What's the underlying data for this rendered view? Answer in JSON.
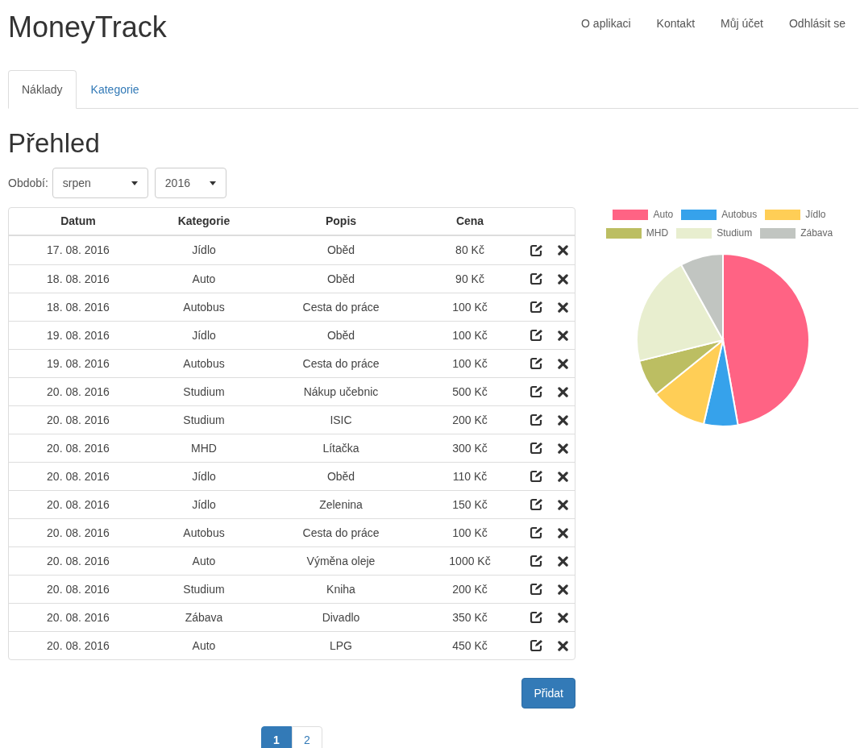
{
  "brand": "MoneyTrack",
  "nav": [
    "O aplikaci",
    "Kontakt",
    "Můj účet",
    "Odhlásit se"
  ],
  "tabs": [
    {
      "label": "Náklady",
      "selected": true
    },
    {
      "label": "Kategorie",
      "selected": false
    }
  ],
  "heading": "Přehled",
  "period": {
    "label": "Období:",
    "month": "srpen",
    "year": "2016"
  },
  "table": {
    "columns": [
      "Datum",
      "Kategorie",
      "Popis",
      "Cena"
    ],
    "rows": [
      [
        "17. 08. 2016",
        "Jídlo",
        "Oběd",
        "80 Kč"
      ],
      [
        "18. 08. 2016",
        "Auto",
        "Oběd",
        "90 Kč"
      ],
      [
        "18. 08. 2016",
        "Autobus",
        "Cesta do práce",
        "100 Kč"
      ],
      [
        "19. 08. 2016",
        "Jídlo",
        "Oběd",
        "100 Kč"
      ],
      [
        "19. 08. 2016",
        "Autobus",
        "Cesta do práce",
        "100 Kč"
      ],
      [
        "20. 08. 2016",
        "Studium",
        "Nákup učebnic",
        "500 Kč"
      ],
      [
        "20. 08. 2016",
        "Studium",
        "ISIC",
        "200 Kč"
      ],
      [
        "20. 08. 2016",
        "MHD",
        "Lítačka",
        "300 Kč"
      ],
      [
        "20. 08. 2016",
        "Jídlo",
        "Oběd",
        "110 Kč"
      ],
      [
        "20. 08. 2016",
        "Jídlo",
        "Zelenina",
        "150 Kč"
      ],
      [
        "20. 08. 2016",
        "Autobus",
        "Cesta do práce",
        "100 Kč"
      ],
      [
        "20. 08. 2016",
        "Auto",
        "Výměna oleje",
        "1000 Kč"
      ],
      [
        "20. 08. 2016",
        "Studium",
        "Kniha",
        "200 Kč"
      ],
      [
        "20. 08. 2016",
        "Zábava",
        "Divadlo",
        "350 Kč"
      ],
      [
        "20. 08. 2016",
        "Auto",
        "LPG",
        "450 Kč"
      ]
    ]
  },
  "add_button": "Přidat",
  "pagination": [
    {
      "label": "1",
      "selected": true
    },
    {
      "label": "2",
      "selected": false
    }
  ],
  "legend": [
    {
      "label": "Auto",
      "color": "#ff6384"
    },
    {
      "label": "Autobus",
      "color": "#36a2eb"
    },
    {
      "label": "Jídlo",
      "color": "#ffce56"
    },
    {
      "label": "MHD",
      "color": "#bcbe62"
    },
    {
      "label": "Studium",
      "color": "#e8eecf"
    },
    {
      "label": "Zábava",
      "color": "#c1c5c1"
    }
  ]
}
